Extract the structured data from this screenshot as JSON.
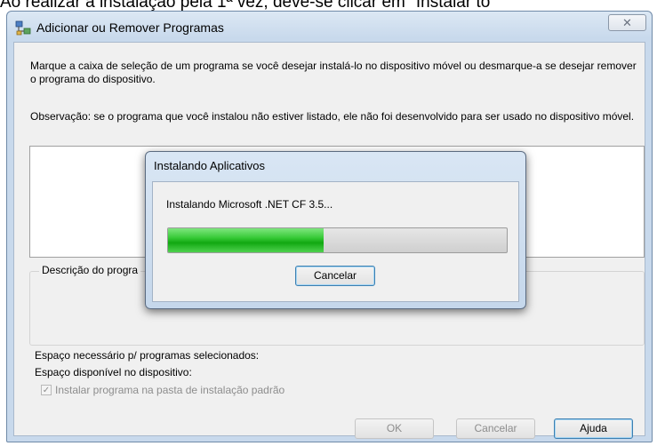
{
  "caption": "Ao realizar a instalação pela 1ª vez, deve-se clicar em \"Instalar to",
  "window": {
    "title": "Adicionar ou Remover Programas",
    "close_glyph": "✕",
    "instructions": "Marque a caixa de seleção de um programa se você desejar instalá-lo no dispositivo móvel ou desmarque-a se desejar remover o programa do dispositivo.",
    "note": "Observação: se o programa que você instalou não estiver listado, ele não foi desenvolvido para ser usado no dispositivo móvel.",
    "description_label": "Descrição do progra",
    "space_required": "Espaço necessário p/ programas selecionados:",
    "space_available": "Espaço disponível no dispositivo:",
    "checkbox_label": "Instalar programa na pasta de instalação padrão",
    "checkbox_checked": true,
    "buttons": {
      "ok": "OK",
      "cancel": "Cancelar",
      "help": "Ajuda"
    }
  },
  "dialog": {
    "title": "Instalando Aplicativos",
    "message": "Instalando Microsoft .NET CF 3.5...",
    "progress_fraction": 0.46,
    "cancel_label": "Cancelar"
  },
  "icons": {
    "app_icon": "install-programs-icon",
    "close": "close-icon",
    "check": "checkmark-icon"
  },
  "colors": {
    "progress_green": "#1fb41f",
    "accent_border": "#3c7fb1"
  }
}
